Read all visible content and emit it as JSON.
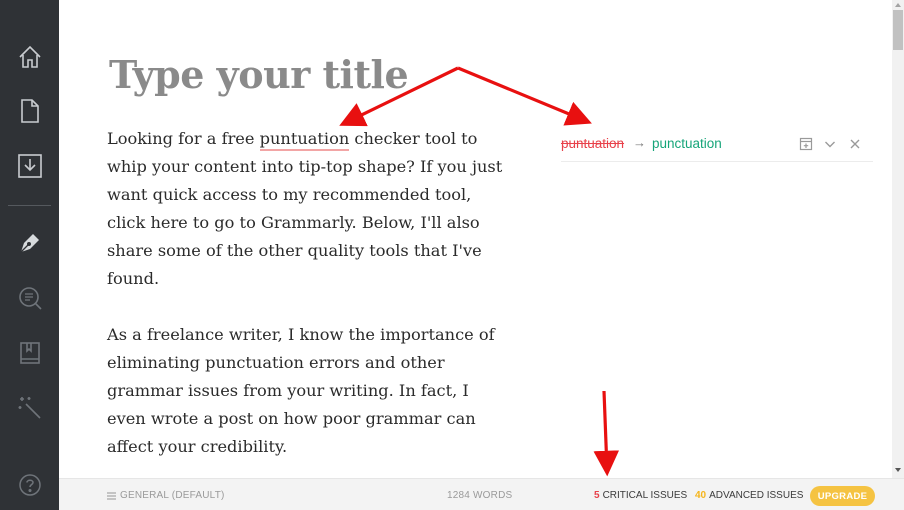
{
  "sidebar": {
    "items": [
      {
        "icon": "home-icon"
      },
      {
        "icon": "document-icon"
      },
      {
        "icon": "download-icon"
      },
      {
        "icon": "pen-icon"
      },
      {
        "icon": "search-icon"
      },
      {
        "icon": "book-icon"
      },
      {
        "icon": "magic-wand-icon"
      },
      {
        "icon": "help-icon"
      }
    ]
  },
  "editor": {
    "title_placeholder": "Type your title",
    "paragraphs": [
      {
        "before": "Looking for a free ",
        "error_word": "puntuation",
        "after": " checker tool to whip your content into tip-top shape? If you just want quick access to my recommended tool, click here to go to Grammarly. Below, I'll also share some of the other quality tools that I've found."
      },
      {
        "text": "As a freelance writer, I know the importance of eliminating punctuation errors and other grammar issues from your writing. In fact, I even wrote a post on how poor grammar can affect your credibility."
      }
    ]
  },
  "suggestion": {
    "wrong": "puntuation",
    "arrow": "→",
    "correct": "punctuation",
    "icons": [
      "add-to-dictionary-icon",
      "expand-icon",
      "dismiss-icon"
    ]
  },
  "statusbar": {
    "goals_label": "GENERAL (DEFAULT)",
    "word_count": "1284 WORDS",
    "critical_count": "5",
    "critical_label": "CRITICAL ISSUES",
    "advanced_count": "40",
    "advanced_label": "ADVANCED ISSUES",
    "upgrade_label": "UPGRADE"
  },
  "colors": {
    "sidebar_bg": "#2f3236",
    "error_red": "#e8414a",
    "correct_green": "#16a579",
    "advanced_yellow": "#f5b51c",
    "upgrade_bg": "#f5c342",
    "annotation_arrow": "#e81010"
  }
}
